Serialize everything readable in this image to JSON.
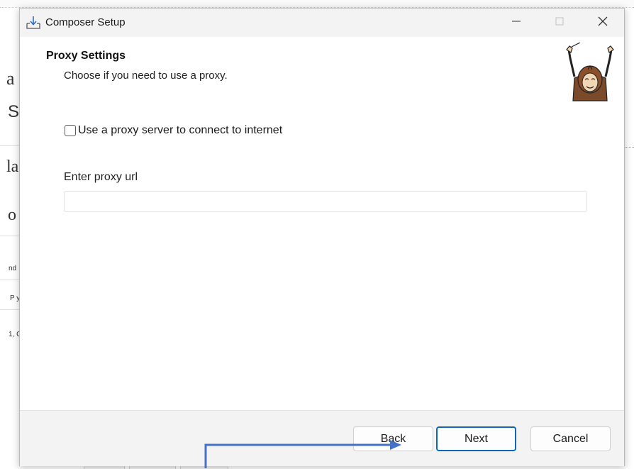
{
  "background": {
    "fragments": [
      "a",
      "S",
      "la",
      "o",
      "nd",
      "P y",
      "1, C"
    ]
  },
  "window": {
    "title": "Composer Setup",
    "app_icon": "download-icon",
    "controls": {
      "minimize_icon": "minimize-icon",
      "maximize_icon": "maximize-icon",
      "close_icon": "close-icon"
    }
  },
  "page": {
    "heading": "Proxy Settings",
    "subheading": "Choose if you need to use a proxy.",
    "mascot": "composer-conductor-logo"
  },
  "proxy": {
    "checkbox_label": "Use a proxy server to connect to internet",
    "checked": false,
    "url_label": "Enter proxy url",
    "url_value": "",
    "url_placeholder": ""
  },
  "footer": {
    "back_label": "Back",
    "next_label": "Next",
    "cancel_label": "Cancel"
  },
  "colors": {
    "accent": "#0f67b8",
    "annotation_arrow": "#4472c4",
    "titlebar_bg": "#f3f3f3",
    "footer_bg": "#f3f3f3"
  }
}
